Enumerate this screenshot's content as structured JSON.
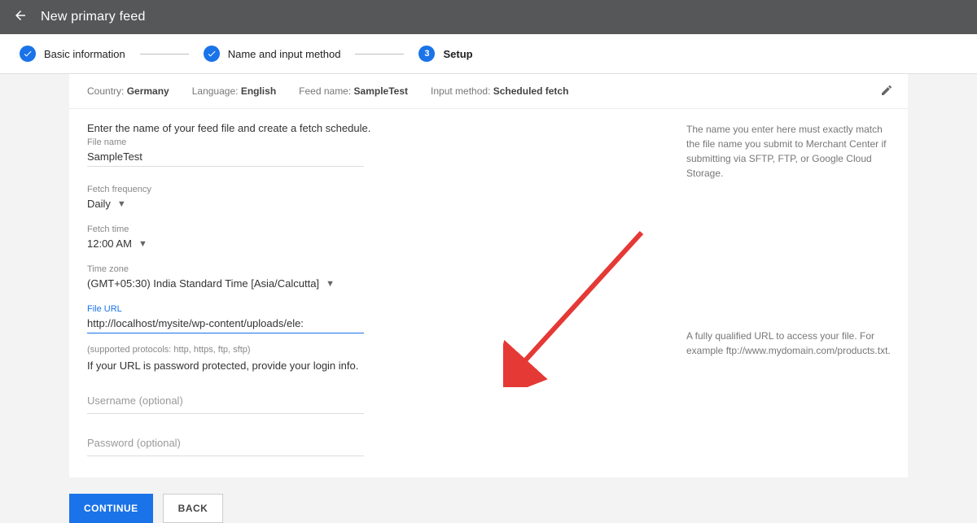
{
  "header": {
    "title": "New primary feed"
  },
  "stepper": {
    "steps": [
      {
        "label": "Basic information"
      },
      {
        "label": "Name and input method"
      },
      {
        "label": "Setup",
        "number": "3"
      }
    ]
  },
  "summary": {
    "country_label": "Country:",
    "country": "Germany",
    "lang_label": "Language:",
    "lang": "English",
    "feed_label": "Feed name:",
    "feed": "SampleTest",
    "method_label": "Input method:",
    "method": "Scheduled fetch"
  },
  "form": {
    "intro": "Enter the name of your feed file and create a fetch schedule.",
    "filename_label": "File name",
    "filename": "SampleTest",
    "freq_label": "Fetch frequency",
    "freq": "Daily",
    "time_label": "Fetch time",
    "time": "12:00 AM",
    "tz_label": "Time zone",
    "tz": "(GMT+05:30) India Standard Time [Asia/Calcutta]",
    "url_label": "File URL",
    "url": "http://localhost/mysite/wp-content/uploads/ele:",
    "sup": "(supported protocols: http, https, ftp, sftp)",
    "prot": "If your URL is password protected, provide your login info.",
    "user_ph": "Username (optional)",
    "pass_ph": "Password (optional)"
  },
  "help": {
    "filename": "The name you enter here must exactly match the file name you submit to Merchant Center if submitting via SFTP, FTP, or Google Cloud Storage.",
    "url": "A fully qualified URL to access your file. For example ftp://www.mydomain.com/products.txt."
  },
  "footer": {
    "continue": "Continue",
    "back": "Back"
  }
}
